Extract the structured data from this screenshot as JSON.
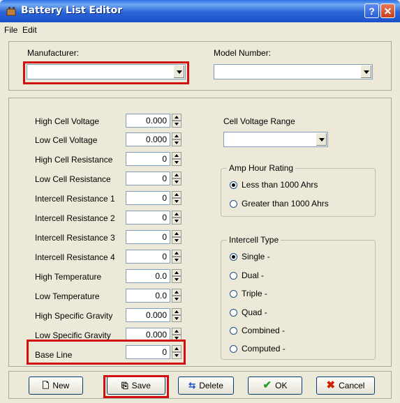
{
  "window": {
    "title": "Battery List Editor"
  },
  "titlebar": {
    "help_glyph": "?",
    "close_glyph": "✕"
  },
  "menu": {
    "file": "File",
    "edit": "Edit"
  },
  "top": {
    "manufacturer_label": "Manufacturer:",
    "manufacturer_value": "",
    "model_label": "Model Number:",
    "model_value": ""
  },
  "fields": [
    {
      "label": "High Cell Voltage",
      "value": "0.000"
    },
    {
      "label": "Low Cell Voltage",
      "value": "0.000"
    },
    {
      "label": "High Cell Resistance",
      "value": "0"
    },
    {
      "label": "Low Cell Resistance",
      "value": "0"
    },
    {
      "label": "Intercell Resistance 1",
      "value": "0"
    },
    {
      "label": "Intercell Resistance 2",
      "value": "0"
    },
    {
      "label": "Intercell Resistance 3",
      "value": "0"
    },
    {
      "label": "Intercell Resistance 4",
      "value": "0"
    },
    {
      "label": "High Temperature",
      "value": "0.0"
    },
    {
      "label": "Low Temperature",
      "value": "0.0"
    },
    {
      "label": "High Specific Gravity",
      "value": "0.000"
    },
    {
      "label": "Low Specific Gravity",
      "value": "0.000"
    },
    {
      "label": "Base Line",
      "value": "0"
    }
  ],
  "cell_voltage_range": {
    "label": "Cell Voltage Range",
    "value": ""
  },
  "amp_hour": {
    "title": "Amp Hour Rating",
    "options": [
      {
        "label": "Less than 1000 Ahrs",
        "selected": true
      },
      {
        "label": "Greater than 1000 Ahrs",
        "selected": false
      }
    ]
  },
  "intercell": {
    "title": "Intercell Type",
    "options": [
      {
        "label": "Single  -",
        "selected": true
      },
      {
        "label": "Dual  -",
        "selected": false
      },
      {
        "label": "Triple  -",
        "selected": false
      },
      {
        "label": "Quad  -",
        "selected": false
      },
      {
        "label": "Combined  -",
        "selected": false
      },
      {
        "label": "Computed  -",
        "selected": false
      }
    ]
  },
  "buttons": {
    "new": "New",
    "save": "Save",
    "delete": "Delete",
    "ok": "OK",
    "cancel": "Cancel"
  },
  "colors": {
    "highlight": "#d01010",
    "titlebar": "#2a66d8",
    "ok_check": "#2a9a2a",
    "cancel_x": "#cc2200"
  }
}
